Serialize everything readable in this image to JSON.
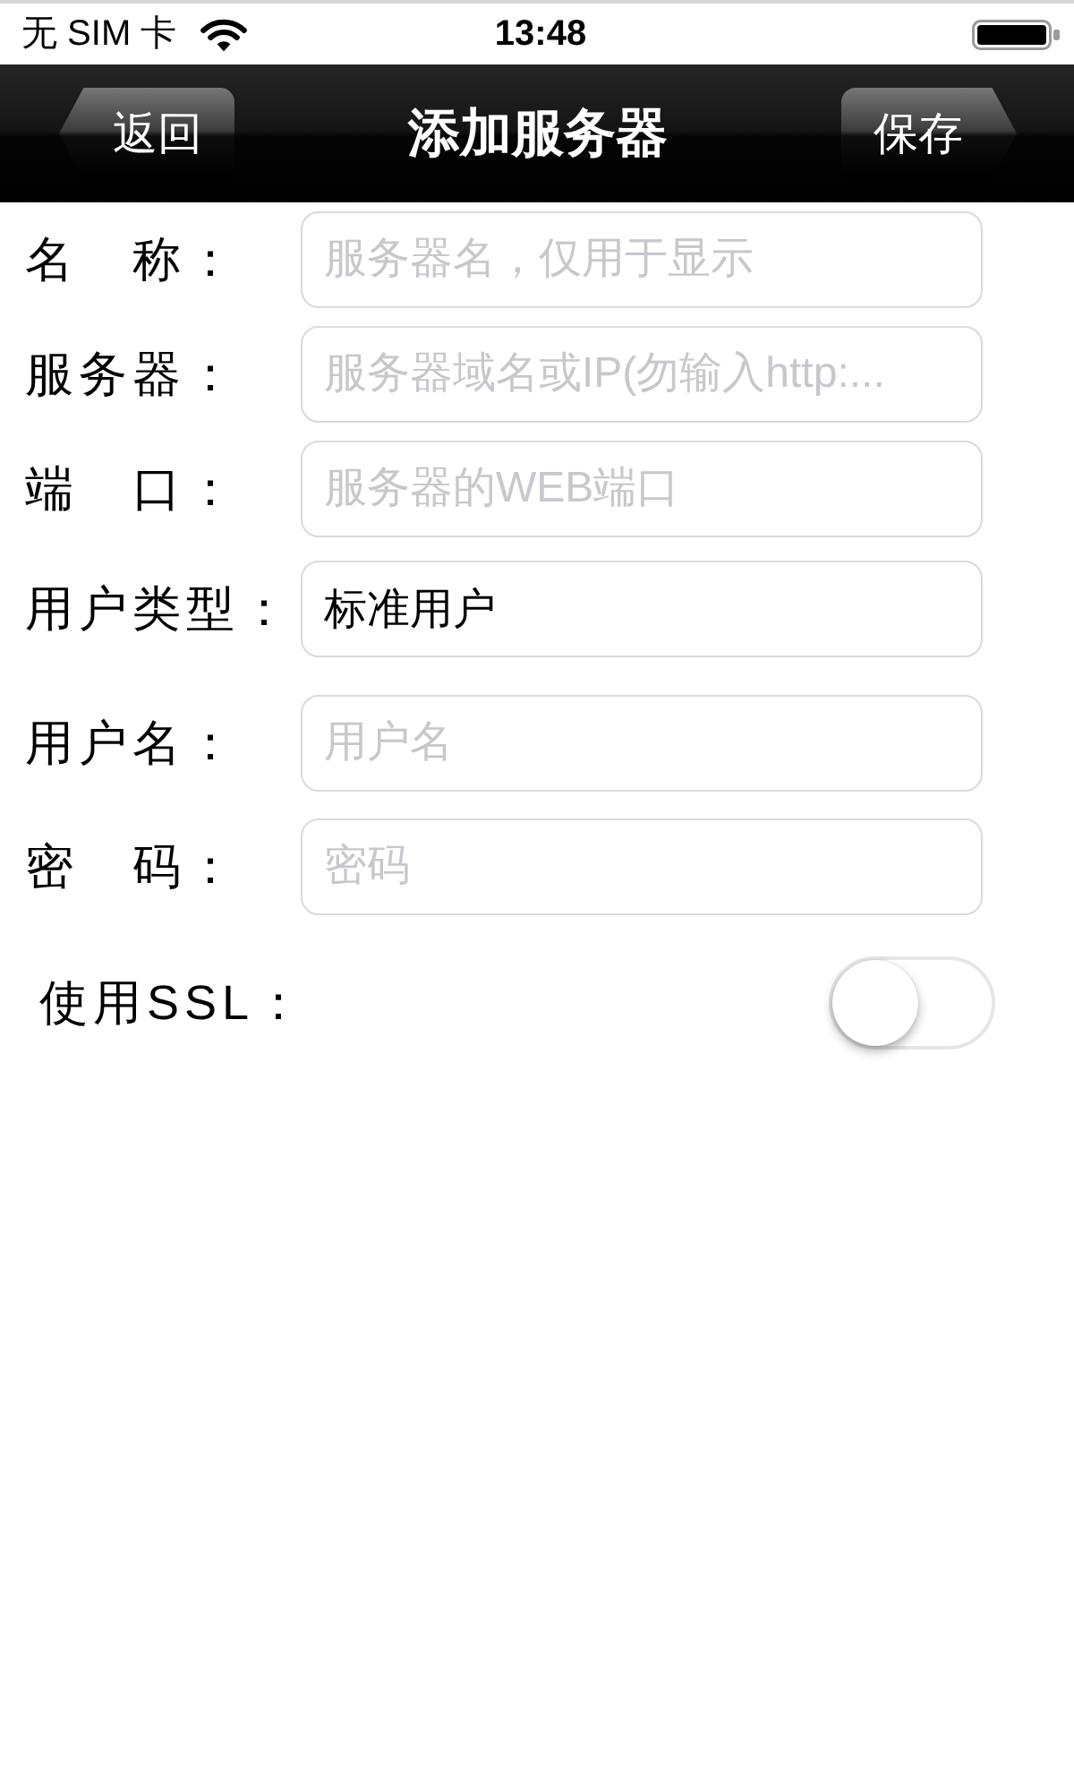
{
  "status_bar": {
    "carrier": "无 SIM 卡",
    "time": "13:48"
  },
  "nav_bar": {
    "back_button": "返回",
    "title": "添加服务器",
    "save_button": "保存"
  },
  "fields": [
    {
      "label": "名　称：",
      "placeholder": "服务器名，仅用于显示"
    },
    {
      "label": "服务器：",
      "placeholder": "服务器域名或IP(勿输入http:..."
    },
    {
      "label": "端　口：",
      "placeholder": "服务器的WEB端口"
    },
    {
      "label": "用户类型：",
      "value": "标准用户"
    },
    {
      "label": "用户名：",
      "placeholder": "用户名"
    },
    {
      "label": "密　码：",
      "placeholder": "密码"
    }
  ],
  "ssl": {
    "label": "使用SSL：",
    "on": false
  }
}
